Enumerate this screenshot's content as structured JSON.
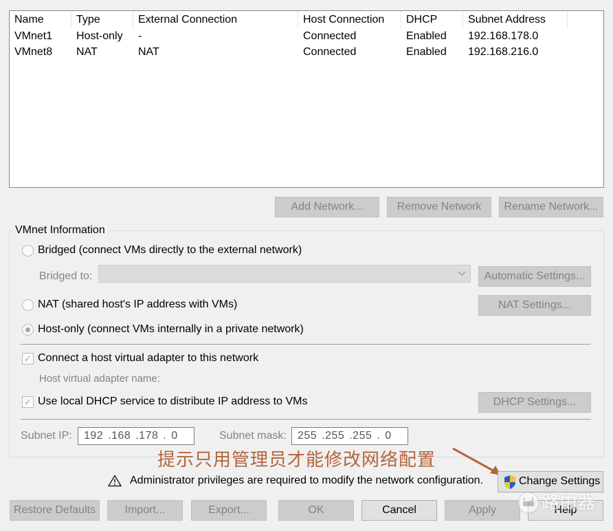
{
  "table": {
    "columns": [
      "Name",
      "Type",
      "External Connection",
      "Host Connection",
      "DHCP",
      "Subnet Address"
    ],
    "rows": [
      [
        "VMnet1",
        "Host-only",
        "-",
        "Connected",
        "Enabled",
        "192.168.178.0"
      ],
      [
        "VMnet8",
        "NAT",
        "NAT",
        "Connected",
        "Enabled",
        "192.168.216.0"
      ]
    ]
  },
  "table_buttons": {
    "add": "Add Network...",
    "remove": "Remove Network",
    "rename": "Rename Network..."
  },
  "vmnet_info": {
    "title": "VMnet Information",
    "bridged_label": "Bridged (connect VMs directly to the external network)",
    "bridged_to_label": "Bridged to:",
    "automatic_settings": "Automatic Settings...",
    "nat_label": "NAT (shared host's IP address with VMs)",
    "nat_settings": "NAT Settings...",
    "hostonly_label": "Host-only (connect VMs internally in a private network)",
    "selected_mode": "host-only",
    "connect_adapter_label": "Connect a host virtual adapter to this network",
    "connect_adapter_checked": true,
    "adapter_name_label": "Host virtual adapter name:",
    "dhcp_label": "Use local DHCP service to distribute IP address to VMs",
    "dhcp_checked": true,
    "dhcp_settings": "DHCP Settings...",
    "subnet_ip_label": "Subnet IP:",
    "subnet_ip_value": "192 .168 .178 . 0",
    "subnet_mask_label": "Subnet mask:",
    "subnet_mask_value": "255 .255 .255 . 0"
  },
  "annotation": "提示只用管理员才能修改网络配置",
  "admin_notice": "Administrator privileges are required to modify the network configuration.",
  "change_settings": "Change Settings",
  "bottom_buttons": {
    "restore": "Restore Defaults",
    "import": "Import...",
    "export": "Export...",
    "ok": "OK",
    "cancel": "Cancel",
    "apply": "Apply",
    "help": "Help"
  },
  "watermark": "路由器",
  "colors": {
    "annotation": "#b5653b",
    "shield_blue": "#1f5fbf",
    "shield_yellow": "#f4c430"
  }
}
